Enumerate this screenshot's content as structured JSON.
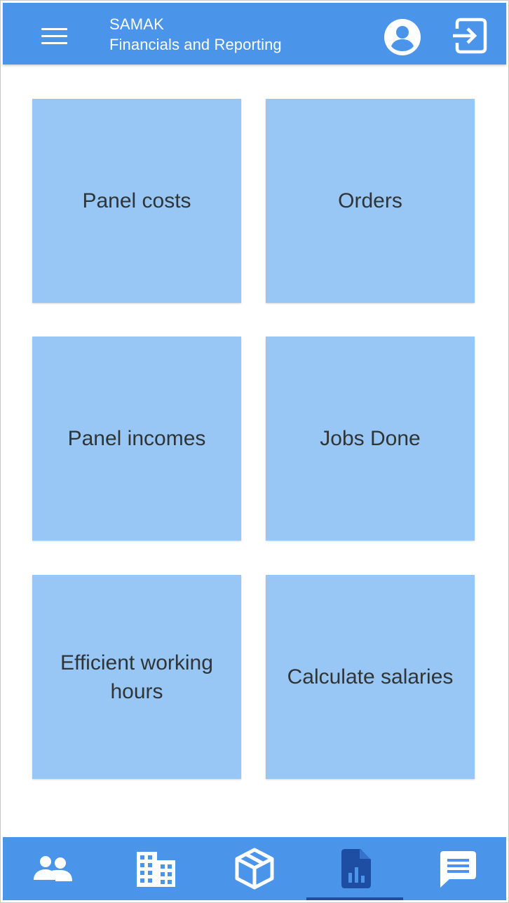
{
  "colors": {
    "primary": "#4a94ea",
    "tile": "#99c7f5",
    "active_icon": "#1e4da4",
    "icon": "#ffffff",
    "tile_text": "#2f3437"
  },
  "header": {
    "app_name": "SAMAK",
    "subtitle": "Financials and Reporting",
    "menu_icon": "menu-icon",
    "account_icon": "account-circle-icon",
    "logout_icon": "exit-to-app-icon"
  },
  "tiles": [
    {
      "label": "Panel costs"
    },
    {
      "label": "Orders"
    },
    {
      "label": "Panel incomes"
    },
    {
      "label": "Jobs Done"
    },
    {
      "label": "Efficient working hours"
    },
    {
      "label": "Calculate salaries"
    }
  ],
  "bottom_nav": {
    "active_index": 3,
    "items": [
      {
        "icon": "people-icon"
      },
      {
        "icon": "building-icon"
      },
      {
        "icon": "package-icon"
      },
      {
        "icon": "report-chart-icon"
      },
      {
        "icon": "message-icon"
      }
    ]
  }
}
